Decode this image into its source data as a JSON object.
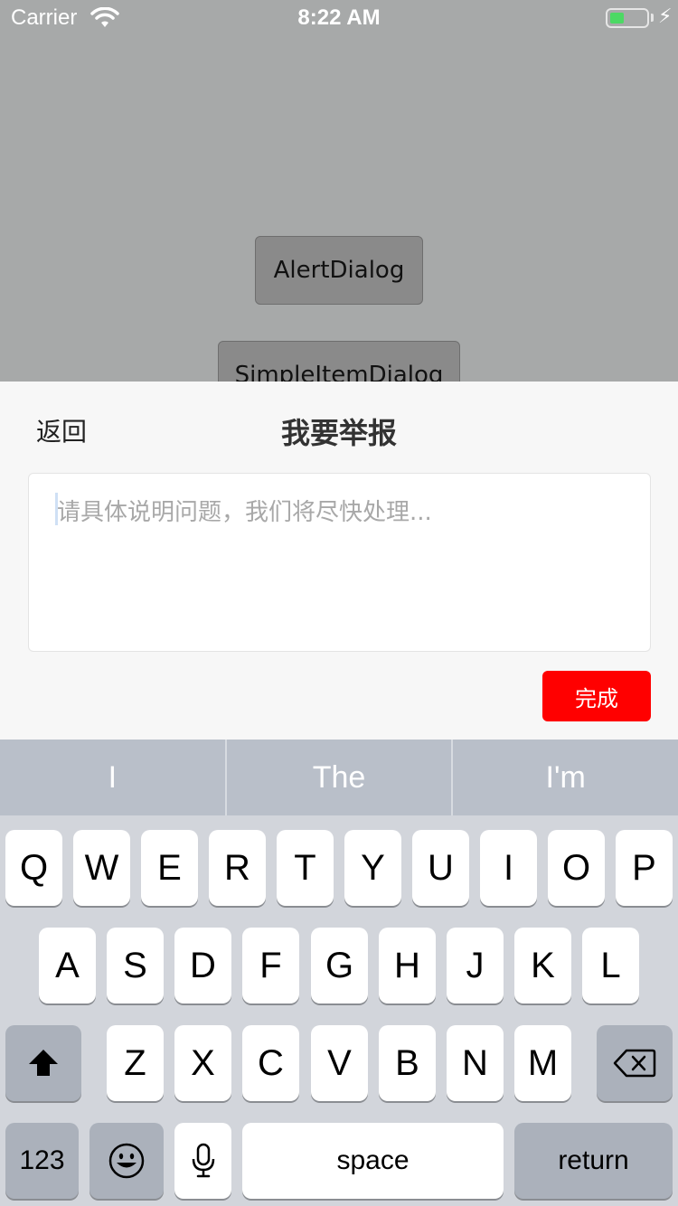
{
  "status_bar": {
    "carrier": "Carrier",
    "time": "8:22 AM"
  },
  "background_app": {
    "buttons": [
      "AlertDialog",
      "SimpleItemDialog"
    ]
  },
  "report_sheet": {
    "back_label": "返回",
    "title": "我要举报",
    "input_placeholder": "请具体说明问题，我们将尽快处理...",
    "done_label": "完成",
    "accent_color": "#ff0000"
  },
  "keyboard": {
    "suggestions": [
      "I",
      "The",
      "I'm"
    ],
    "row1": [
      "Q",
      "W",
      "E",
      "R",
      "T",
      "Y",
      "U",
      "I",
      "O",
      "P"
    ],
    "row2": [
      "A",
      "S",
      "D",
      "F",
      "G",
      "H",
      "J",
      "K",
      "L"
    ],
    "row3": [
      "Z",
      "X",
      "C",
      "V",
      "B",
      "N",
      "M"
    ],
    "numbers_label": "123",
    "space_label": "space",
    "return_label": "return",
    "icons": {
      "shift": "shift-icon",
      "delete": "backspace-icon",
      "emoji": "emoji-icon",
      "mic": "microphone-icon"
    }
  }
}
